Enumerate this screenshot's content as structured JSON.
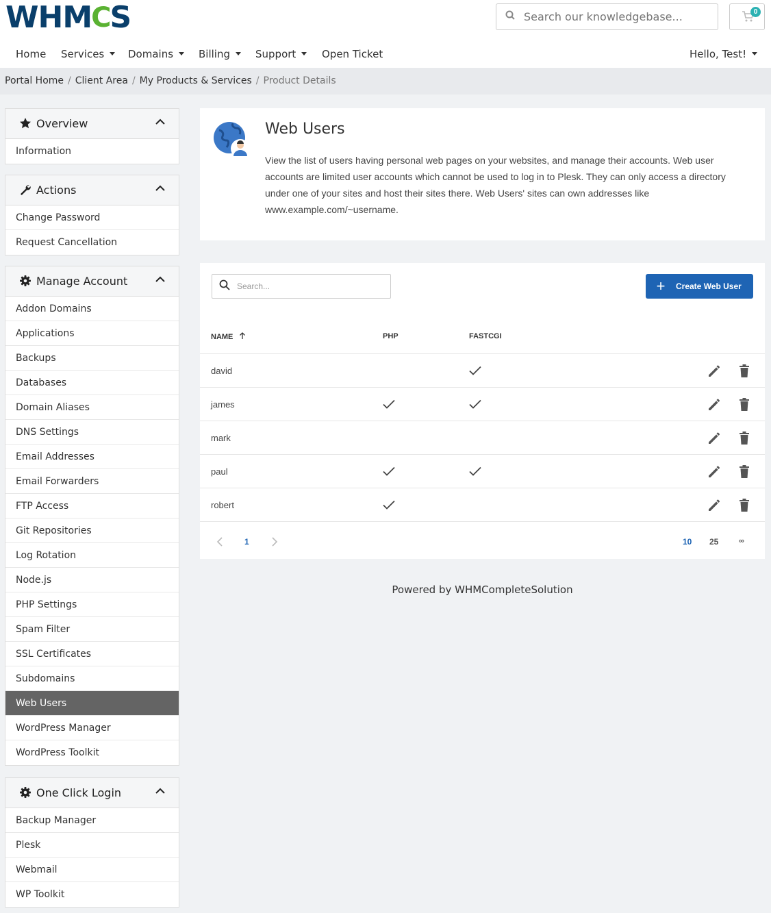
{
  "header": {
    "logo_prefix": "WHM",
    "logo_gear": "C",
    "logo_suffix": "S",
    "search_placeholder": "Search our knowledgebase...",
    "cart_count": "0",
    "cart_icon": "cart-icon"
  },
  "nav": {
    "items": [
      {
        "label": "Home",
        "dropdown": false
      },
      {
        "label": "Services",
        "dropdown": true
      },
      {
        "label": "Domains",
        "dropdown": true
      },
      {
        "label": "Billing",
        "dropdown": true
      },
      {
        "label": "Support",
        "dropdown": true
      },
      {
        "label": "Open Ticket",
        "dropdown": false
      }
    ],
    "user": "Hello, Test!"
  },
  "breadcrumb": [
    "Portal Home",
    "Client Area",
    "My Products & Services",
    "Product Details"
  ],
  "sidebar": {
    "overview": {
      "title": "Overview",
      "icon": "star-icon",
      "items": [
        "Information"
      ]
    },
    "actions": {
      "title": "Actions",
      "icon": "wrench-icon",
      "items": [
        "Change Password",
        "Request Cancellation"
      ]
    },
    "manage": {
      "title": "Manage Account",
      "icon": "gear-icon",
      "active": "Web Users",
      "items": [
        "Addon Domains",
        "Applications",
        "Backups",
        "Databases",
        "Domain Aliases",
        "DNS Settings",
        "Email Addresses",
        "Email Forwarders",
        "FTP Access",
        "Git Repositories",
        "Log Rotation",
        "Node.js",
        "PHP Settings",
        "Spam Filter",
        "SSL Certificates",
        "Subdomains",
        "Web Users",
        "WordPress Manager",
        "WordPress Toolkit"
      ]
    },
    "oneclick": {
      "title": "One Click Login",
      "icon": "gear-icon",
      "items": [
        "Backup Manager",
        "Plesk",
        "Webmail",
        "WP Toolkit"
      ]
    }
  },
  "intro": {
    "title": "Web Users",
    "icon": "globe-user-icon",
    "text": "View the list of users having personal web pages on your websites, and manage their accounts. Web user accounts are limited user accounts which cannot be used to log in to Plesk. They can only access a directory under one of your sites and host their sites there. Web Users' sites can own addresses like www.example.com/~username."
  },
  "table": {
    "search_placeholder": "Search...",
    "create_label": "Create Web User",
    "columns": {
      "name": "NAME",
      "php": "PHP",
      "fastcgi": "FASTCGI"
    },
    "rows": [
      {
        "name": "david",
        "php": false,
        "fastcgi": true
      },
      {
        "name": "james",
        "php": true,
        "fastcgi": true
      },
      {
        "name": "mark",
        "php": false,
        "fastcgi": false
      },
      {
        "name": "paul",
        "php": true,
        "fastcgi": true
      },
      {
        "name": "robert",
        "php": true,
        "fastcgi": false
      }
    ],
    "pagination": {
      "current": "1",
      "page_sizes": [
        "10",
        "25",
        "∞"
      ],
      "active_size": "10"
    }
  },
  "footer": {
    "text": "Powered by WHMCompleteSolution"
  }
}
